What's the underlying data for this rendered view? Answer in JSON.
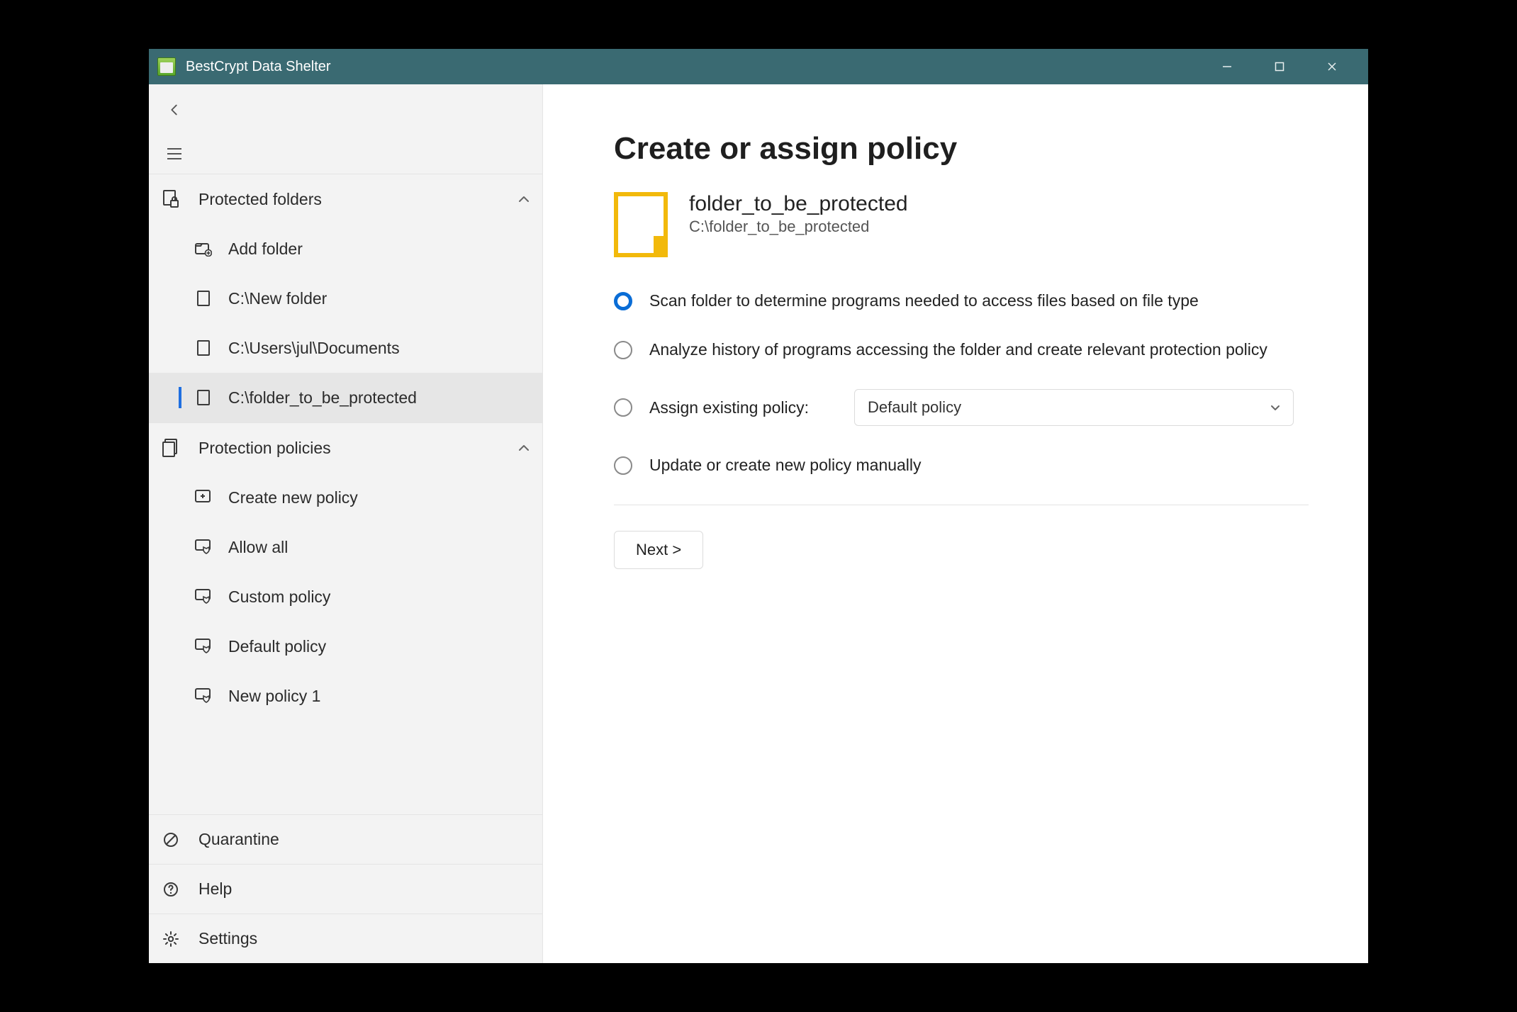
{
  "window": {
    "title": "BestCrypt Data Shelter"
  },
  "sidebar": {
    "sections": [
      {
        "label": "Protected folders",
        "items": [
          {
            "label": "Add folder"
          },
          {
            "label": "C:\\New folder"
          },
          {
            "label": "C:\\Users\\jul\\Documents"
          },
          {
            "label": "C:\\folder_to_be_protected"
          }
        ]
      },
      {
        "label": "Protection policies",
        "items": [
          {
            "label": "Create new policy"
          },
          {
            "label": "Allow all"
          },
          {
            "label": "Custom policy"
          },
          {
            "label": "Default policy"
          },
          {
            "label": "New policy 1"
          }
        ]
      }
    ],
    "bottom": [
      {
        "label": "Quarantine"
      },
      {
        "label": "Help"
      },
      {
        "label": "Settings"
      }
    ]
  },
  "main": {
    "heading": "Create or assign policy",
    "folder": {
      "name": "folder_to_be_protected",
      "path": "C:\\folder_to_be_protected"
    },
    "options": [
      "Scan folder to determine programs needed to access files based on file type",
      "Analyze history of programs accessing the folder and create relevant protection policy",
      "Assign existing policy:",
      "Update or create new policy manually"
    ],
    "selectedOptionIndex": 0,
    "policySelect": {
      "value": "Default policy"
    },
    "nextLabel": "Next >"
  }
}
